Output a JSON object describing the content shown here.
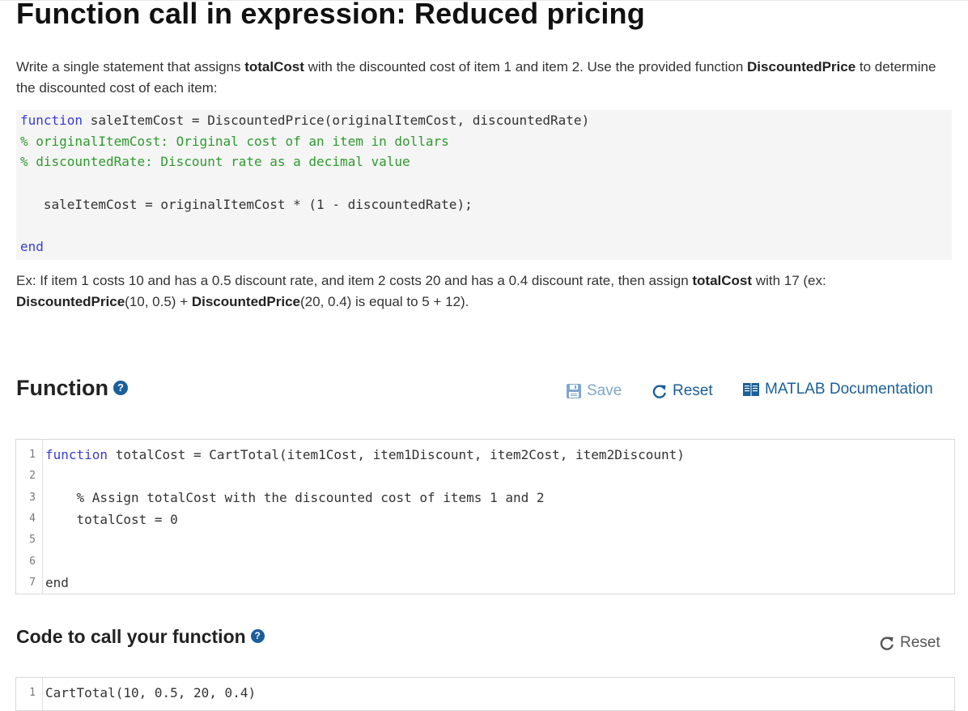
{
  "title": "Function call in expression: Reduced pricing",
  "instructions": {
    "p1_a": "Write a single statement that assigns ",
    "p1_b": "totalCost",
    "p1_c": " with the discounted cost of item 1 and item 2. Use the provided function ",
    "p1_d": "DiscountedPrice",
    "p1_e": " to determine the discounted cost of each item:",
    "p2_a": "Ex: If item 1 costs 10 and has a 0.5 discount rate, and item 2 costs 20 and has a 0.4 discount rate, then assign ",
    "p2_b": "totalCost",
    "p2_c": " with 17 (ex: ",
    "p2_d": "DiscountedPrice",
    "p2_e": "(10, 0.5) + ",
    "p2_f": "DiscountedPrice",
    "p2_g": "(20, 0.4) is equal to 5 + 12)."
  },
  "example_code": {
    "l1_kw": "function",
    "l1_rest": " saleItemCost = DiscountedPrice(originalItemCost, discountedRate)",
    "l2": "% originalItemCost: Original cost of an item in dollars",
    "l3": "% discountedRate: Discount rate as a decimal value",
    "l4": "   saleItemCost = originalItemCost * (1 - discountedRate);",
    "l5_kw": "end"
  },
  "function_section": {
    "title": "Function",
    "help_icon_glyph": "?",
    "save_label": "Save",
    "reset_label": "Reset",
    "doc_label": "MATLAB Documentation"
  },
  "editor": {
    "line_numbers": [
      "1",
      "2",
      "3",
      "4",
      "5",
      "6",
      "7"
    ],
    "l1_kw": "function",
    "l1_rest": " totalCost = CartTotal(item1Cost, item1Discount, item2Cost, item2Discount)",
    "l3": "    % Assign totalCost with the discounted cost of items 1 and 2",
    "l4": "    totalCost = 0",
    "l7_kw": "end"
  },
  "call_section": {
    "title": "Code to call your function",
    "help_icon_glyph": "?",
    "reset_label": "Reset"
  },
  "call_editor": {
    "line_number": "1",
    "l1": "CartTotal(10, 0.5, 20, 0.4)"
  },
  "colors": {
    "accent": "#1a5f9a",
    "save_disabled": "#7fa7cc",
    "keyword": "#3b3bd6",
    "comment": "#2e9b2e"
  }
}
